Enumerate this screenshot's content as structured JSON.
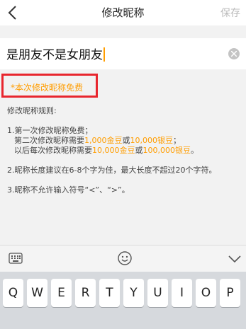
{
  "nav": {
    "title": "修改昵称",
    "save_label": "保存"
  },
  "nickname": {
    "value": "是朋友不是女朋友"
  },
  "free_notice": "*本次修改昵称免费",
  "rules": {
    "heading": "修改昵称规则:",
    "r1_l1": "1.第一次修改昵称免费；",
    "r1_l2_a": "第二次修改昵称需要",
    "r1_l2_gold": "1,000金豆",
    "r1_l2_or": "或",
    "r1_l2_silver": "10,000银豆",
    "r1_l2_end": "；",
    "r1_l3_a": "以后每次修改昵称需要",
    "r1_l3_gold": "10,000金豆",
    "r1_l3_or": "或",
    "r1_l3_silver": "100,000银豆",
    "r1_l3_end": "。",
    "r2": "2.昵称长度建议在6-8个字为佳，最大长度不超过20个字符。",
    "r3": "3.昵称不允许输入符号“<”、“>”。"
  },
  "colors": {
    "accent": "#ff9d00",
    "highlight_border": "#e8262e"
  },
  "keyboard": {
    "keys": [
      "Q",
      "W",
      "E",
      "R",
      "T",
      "Y",
      "U",
      "I",
      "O",
      "P"
    ]
  }
}
